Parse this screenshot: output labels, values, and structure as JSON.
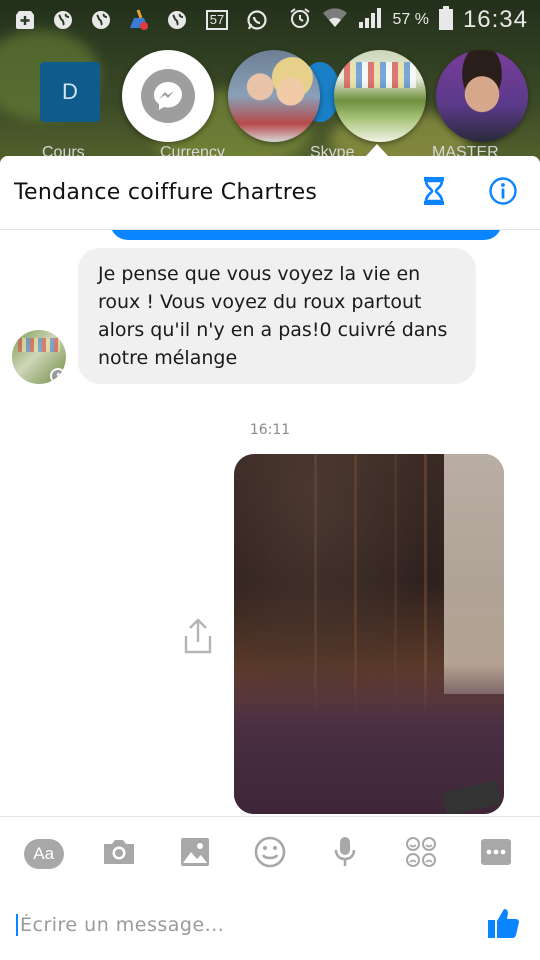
{
  "status_bar": {
    "battery_percent": "57 %",
    "time": "16:34",
    "notification_badge": "57",
    "icons": [
      "plus-box-icon",
      "globe-icon",
      "globe-icon",
      "cleaner-icon",
      "globe-icon",
      "notification-count-icon",
      "whatsapp-icon",
      "alarm-icon",
      "wifi-icon",
      "signal-icon",
      "battery-icon"
    ]
  },
  "home_screen": {
    "labels": [
      "Cours",
      "Currency",
      "Skype",
      "MASTER"
    ],
    "icon_letter": "D"
  },
  "chat_heads": {
    "items": [
      "messenger-head",
      "couple-contact-head",
      "salon-contact-head",
      "young-man-contact-head"
    ],
    "active_index": 2
  },
  "conversation": {
    "title": "Tendance coiffure Chartres",
    "header_icons": [
      "hourglass-icon",
      "info-icon"
    ],
    "incoming_message": "Je pense que vous voyez la vie en roux ! Vous voyez du roux partout alors qu'il n'y en a pas!0 cuivré dans notre mélange",
    "timestamp": "16:11",
    "avatar_badge": "f",
    "photo": "hair-photo"
  },
  "composer": {
    "aa_label": "Aa",
    "placeholder": "Écrire un message...",
    "toolbar_icons": [
      "text-style-icon",
      "camera-icon",
      "gallery-icon",
      "emoji-icon",
      "microphone-icon",
      "stickers-icon",
      "more-icon"
    ],
    "send_icon": "thumbs-up-icon"
  },
  "colors": {
    "accent": "#0A84FF",
    "bubble_in": "#F0F0F0",
    "toolbar_icon": "#9E9E9E"
  }
}
